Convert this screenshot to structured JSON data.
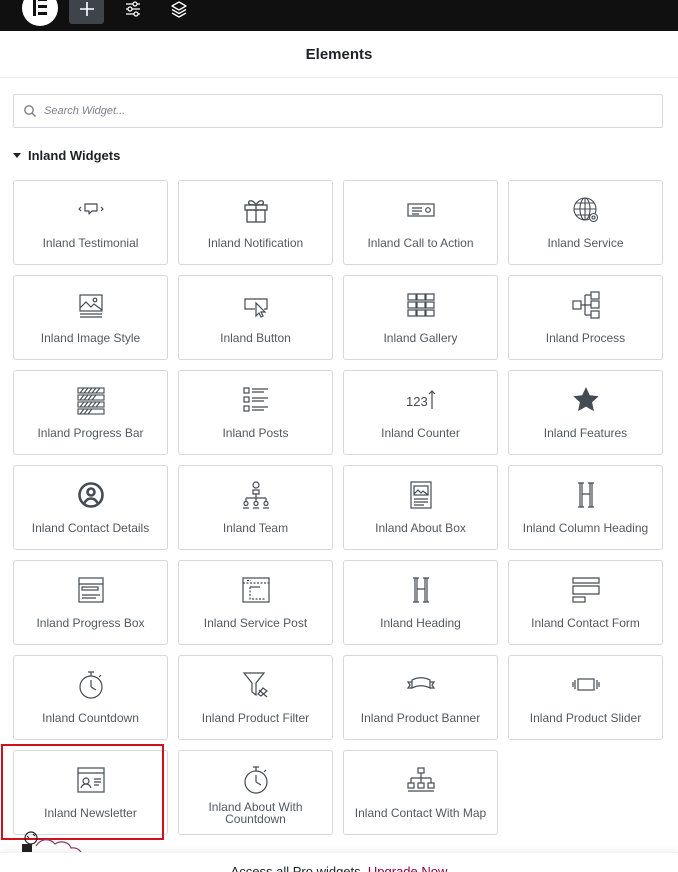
{
  "topbar": {
    "logo": "elementor-logo",
    "add_icon": "plus-icon",
    "settings_icon": "sliders-icon",
    "navigator_icon": "layers-icon"
  },
  "header": {
    "title": "Elements"
  },
  "search": {
    "placeholder": "Search Widget...",
    "value": ""
  },
  "category": {
    "title": "Inland Widgets"
  },
  "widgets": [
    {
      "label": "Inland Testimonial",
      "icon": "testimonial-icon"
    },
    {
      "label": "Inland Notification",
      "icon": "gift-icon"
    },
    {
      "label": "Inland Call to Action",
      "icon": "call-to-action-icon"
    },
    {
      "label": "Inland Service",
      "icon": "globe-gear-icon"
    },
    {
      "label": "Inland Image Style",
      "icon": "image-icon"
    },
    {
      "label": "Inland Button",
      "icon": "button-cursor-icon"
    },
    {
      "label": "Inland Gallery",
      "icon": "gallery-icon"
    },
    {
      "label": "Inland Process",
      "icon": "process-icon"
    },
    {
      "label": "Inland Progress Bar",
      "icon": "progress-bars-icon"
    },
    {
      "label": "Inland Posts",
      "icon": "posts-list-icon"
    },
    {
      "label": "Inland Counter",
      "icon": "counter-icon"
    },
    {
      "label": "Inland Features",
      "icon": "star-icon"
    },
    {
      "label": "Inland Contact Details",
      "icon": "user-circle-icon"
    },
    {
      "label": "Inland Team",
      "icon": "team-hierarchy-icon"
    },
    {
      "label": "Inland About Box",
      "icon": "about-box-icon"
    },
    {
      "label": "Inland Column Heading",
      "icon": "heading-h-icon"
    },
    {
      "label": "Inland Progress Box",
      "icon": "progress-box-icon"
    },
    {
      "label": "Inland Service Post",
      "icon": "service-post-icon"
    },
    {
      "label": "Inland Heading",
      "icon": "heading-h-icon"
    },
    {
      "label": "Inland Contact Form",
      "icon": "contact-form-icon"
    },
    {
      "label": "Inland Countdown",
      "icon": "stopwatch-icon"
    },
    {
      "label": "Inland Product Filter",
      "icon": "filter-icon"
    },
    {
      "label": "Inland Product Banner",
      "icon": "banner-ribbon-icon"
    },
    {
      "label": "Inland Product Slider",
      "icon": "slider-icon"
    },
    {
      "label": "Inland Newsletter",
      "icon": "newsletter-icon"
    },
    {
      "label": "Inland About With Countdown",
      "icon": "stopwatch-icon"
    },
    {
      "label": "Inland Contact With Map",
      "icon": "sitemap-icon"
    }
  ],
  "highlighted_widget": "Inland Newsletter",
  "colors": {
    "highlight": "#d0111b",
    "promo_link": "#93003c",
    "topbar": "#101010"
  },
  "promo": {
    "text": "Access all Pro widgets.",
    "link": "Upgrade Now"
  }
}
